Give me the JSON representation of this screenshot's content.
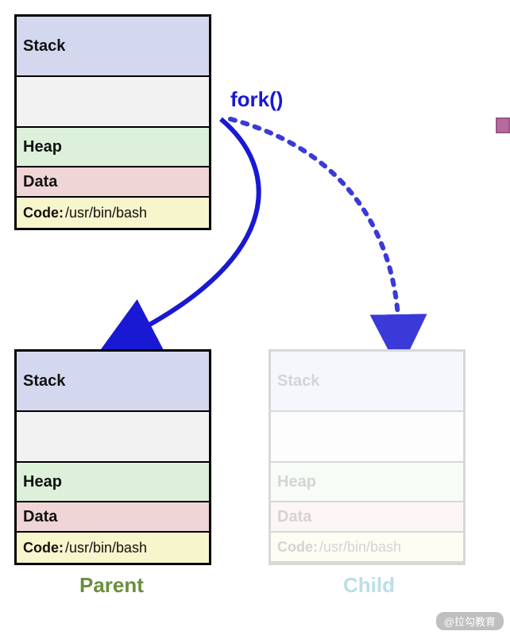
{
  "fork_label": "fork()",
  "top_box": {
    "stack": "Stack",
    "gap": "",
    "heap": "Heap",
    "data": "Data",
    "code_label": "Code:",
    "code_value": "/usr/bin/bash"
  },
  "parent_box": {
    "stack": "Stack",
    "gap": "",
    "heap": "Heap",
    "data": "Data",
    "code_label": "Code:",
    "code_value": "/usr/bin/bash"
  },
  "child_box": {
    "stack": "Stack",
    "gap": "",
    "heap": "Heap",
    "data": "Data",
    "code_label": "Code:",
    "code_value": "/usr/bin/bash"
  },
  "captions": {
    "parent": "Parent",
    "child": "Child"
  },
  "watermark": "@拉勾教育"
}
